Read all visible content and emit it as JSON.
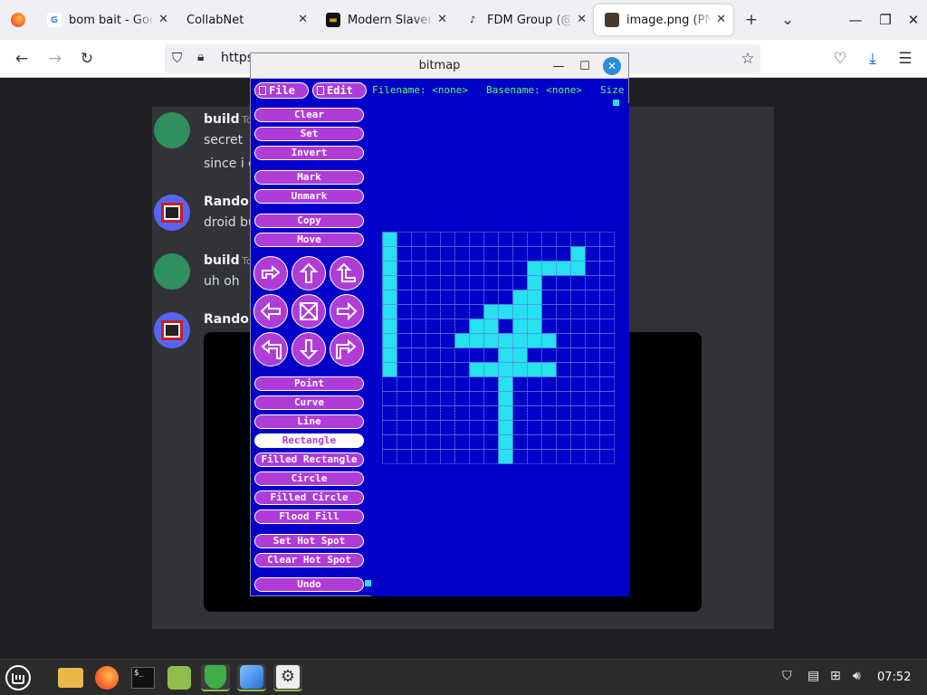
{
  "browser": {
    "tabs": [
      {
        "title": "bom bait - Goog",
        "favicon": "G",
        "active": false
      },
      {
        "title": "CollabNet",
        "favicon": "",
        "active": false
      },
      {
        "title": "Modern Slavery",
        "favicon": "",
        "active": false
      },
      {
        "title": "FDM Group (@F",
        "favicon": "",
        "active": false
      },
      {
        "title": "image.png (PNG",
        "favicon": "",
        "active": true
      }
    ],
    "new_tab": "+",
    "url": "https",
    "colors": {
      "tabbar": "#f0f0f4",
      "accent": "#0061e0"
    }
  },
  "chat": {
    "messages": [
      {
        "user": "build",
        "time": "To",
        "lines": [
          "secret",
          "since i c"
        ]
      },
      {
        "user": "Randon",
        "time": "",
        "lines": [
          "droid bu"
        ]
      },
      {
        "user": "build",
        "time": "To",
        "lines": [
          "uh oh"
        ]
      },
      {
        "user": "Randon",
        "time": "",
        "lines": []
      }
    ]
  },
  "bitmap": {
    "title": "bitmap",
    "menus": [
      "File",
      "Edit"
    ],
    "filename_label": "Filename: <none>",
    "basename_label": "Basename: <none>",
    "size_label": "Size",
    "commands_top": [
      "Clear",
      "Set",
      "Invert",
      "Mark",
      "Unmark",
      "Copy",
      "Move"
    ],
    "commands_draw": [
      "Point",
      "Curve",
      "Line",
      "Rectangle",
      "Filled Rectangle",
      "Circle",
      "Filled Circle",
      "Flood Fill",
      "Set Hot Spot",
      "Clear Hot Spot",
      "Undo"
    ],
    "selected_command": "Rectangle",
    "arrows": [
      "flip-horizontal-icon",
      "up-arrow-icon",
      "flip-vertical-icon",
      "left-arrow-icon",
      "fold-icon",
      "right-arrow-icon",
      "rotate-left-icon",
      "down-arrow-icon",
      "rotate-right-icon"
    ],
    "grid": {
      "cols": 16,
      "rows": 16
    },
    "filled_rows": [
      "1000000000000000",
      "1000000000000100",
      "1000000000111100",
      "1000000000100000",
      "1000000001100000",
      "1000000111100000",
      "1000001101100000",
      "1000011111110000",
      "1000000011000000",
      "1000001111110000",
      "0000000010000000",
      "0000000010000000",
      "0000000010000000",
      "0000000010000000",
      "0000000010000000",
      "0000000010000000"
    ],
    "colors": {
      "bg": "#0000c8",
      "button": "#b03cd8",
      "fill": "#27e0f0",
      "gridline": "#5a7ae0",
      "text": "#5fff5f"
    }
  },
  "taskbar": {
    "apps": [
      "mint-menu-icon",
      "files-icon",
      "firefox-icon",
      "terminal-icon",
      "mint-update-icon",
      "shield-icon",
      "finder-icon",
      "settings-icon"
    ],
    "clock": "07:52"
  }
}
